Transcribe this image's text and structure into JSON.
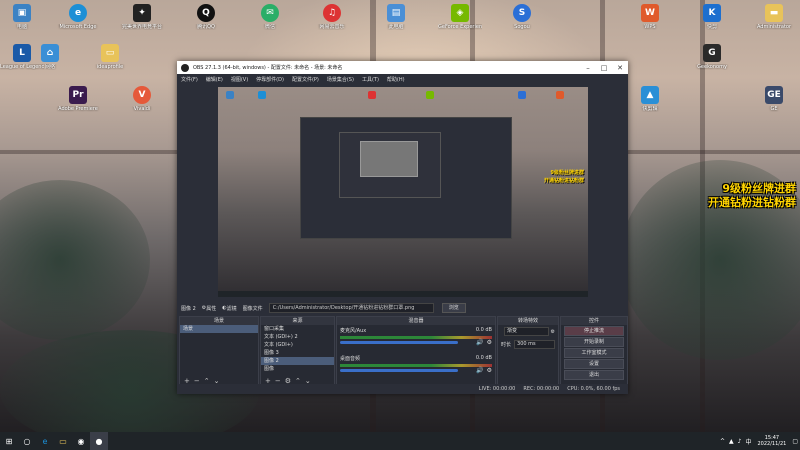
{
  "desktop": {
    "icons_left": [
      {
        "label": "电脑",
        "icon": "computer-icon",
        "color": "#3b82c4"
      },
      {
        "label": "Microsoft Edge",
        "icon": "edge-icon",
        "color": "#1c8fd6"
      },
      {
        "label": "完美世界电竞平台",
        "icon": "perfect-world-icon",
        "color": "#222"
      },
      {
        "label": "腾讯QQ",
        "icon": "qq-icon",
        "color": "#111"
      },
      {
        "label": "微信",
        "icon": "wechat-icon",
        "color": "#2aae67"
      },
      {
        "label": "网易云音乐",
        "icon": "netease-music-icon",
        "color": "#d33"
      },
      {
        "label": "此电脑",
        "icon": "this-pc-icon",
        "color": "#4a8fd6"
      },
      {
        "label": "GeForce Experience",
        "icon": "geforce-icon",
        "color": "#76b900"
      },
      {
        "label": "Sogou",
        "icon": "sogou-icon",
        "color": "#2b6fd6"
      }
    ],
    "icons_left_col": [
      {
        "label": "League of Legends",
        "icon": "lol-icon",
        "color": "#1a5aa8"
      },
      {
        "label": "网络",
        "icon": "network-icon",
        "color": "#3a8fd6"
      },
      {
        "label": "ideaprofile",
        "icon": "folder-icon",
        "color": "#e8c35a"
      },
      {
        "label": "Adobe Premiere",
        "icon": "premiere-icon",
        "color": "#3a1b4e"
      },
      {
        "label": "Vivaldi",
        "icon": "vivaldi-icon",
        "color": "#e5593a"
      }
    ],
    "icons_right": [
      {
        "label": "WPS",
        "icon": "wps-icon",
        "color": "#e05a2b"
      },
      {
        "label": "快剪",
        "icon": "kuaijian-icon",
        "color": "#1d6fcf"
      },
      {
        "label": "Administrator",
        "icon": "user-folder-icon",
        "color": "#e8c35a"
      },
      {
        "label": "Geekonomy",
        "icon": "geek-icon",
        "color": "#2a2a2a"
      },
      {
        "label": "新建",
        "icon": "app-icon",
        "color": "#3a6fd6"
      },
      {
        "label": "快剪辑",
        "icon": "kuaijianji-icon",
        "color": "#2a8fd6"
      },
      {
        "label": "GE",
        "icon": "ge-icon",
        "color": "#3a4a6a"
      }
    ],
    "promo_line1": "9级粉丝牌进群",
    "promo_line2": "开通钻粉进钻粉群"
  },
  "obs": {
    "title": "OBS 27.1.3 (64-bit, windows) - 配置文件: 未命名 - 场景: 未命名",
    "menu": [
      "文件(F)",
      "编辑(E)",
      "视图(V)",
      "停靠部件(D)",
      "配置文件(P)",
      "场景集合(S)",
      "工具(T)",
      "帮助(H)"
    ],
    "source_toolbar": {
      "source_label": "图像 2",
      "props_label": "属性",
      "filters_label": "滤镜",
      "file_label": "图像文件",
      "path": "C:/Users/Administrator/Desktop/开通钻粉进钻粉群口罩.png",
      "browse_label": "浏览"
    },
    "docks": {
      "scenes": {
        "title": "场景",
        "items": [
          "场景"
        ]
      },
      "sources": {
        "title": "来源",
        "items": [
          "窗口采集",
          "文本 (GDI+) 2",
          "文本 (GDI+)",
          "图像 3",
          "图像 2",
          "图像"
        ]
      },
      "mixer": {
        "title": "混音器",
        "channels": [
          {
            "name": "麦克风/Aux",
            "db": "0.0 dB"
          },
          {
            "name": "桌面音频",
            "db": "0.0 dB"
          }
        ]
      },
      "transitions": {
        "title": "转场特效",
        "type": "渐变",
        "duration_label": "时长",
        "duration": "300 ms"
      },
      "controls": {
        "title": "控件",
        "buttons": [
          "停止推流",
          "开始录制",
          "工作室模式",
          "设置",
          "退出"
        ]
      }
    },
    "status": {
      "live": "LIVE: 00:00:00",
      "rec": "REC: 00:00:00",
      "cpu": "CPU: 0.0%, 60.00 fps"
    }
  },
  "taskbar": {
    "start_icon": "windows-start-icon",
    "apps": [
      "search-icon",
      "edge-icon",
      "folder-icon",
      "steam-icon",
      "obs-icon"
    ],
    "time": "15:47",
    "date": "2022/11/21"
  }
}
